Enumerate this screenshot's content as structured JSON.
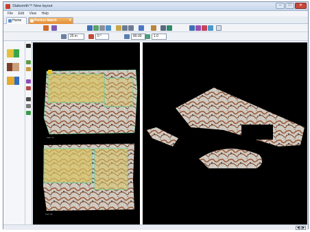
{
  "window": {
    "title": "Slabsmith™ New layout",
    "controls": {
      "minimize": "–",
      "maximize": "□",
      "close": "✕"
    }
  },
  "menu": [
    "File",
    "Edit",
    "View",
    "Help"
  ],
  "tabs": {
    "home": {
      "label": "Home",
      "icon": "home-icon"
    },
    "perfect_match": {
      "label": "Perfect Match",
      "close": "×",
      "icon": "perfect-match-icon"
    }
  },
  "fields": {
    "width": "25 in",
    "rotation": "0 °",
    "offset": "80.00",
    "zoom": "1.0"
  },
  "slabs": [
    {
      "label": "Slab 1A"
    },
    {
      "label": "Slab 1B"
    }
  ],
  "status": {
    "prev": "◀",
    "next": "▶"
  },
  "colors": {
    "accent_tab": "#e38c34",
    "canvas_bg": "#000000",
    "selection_fill": "#d9c463",
    "selection_outline": "#5bd6a0"
  }
}
